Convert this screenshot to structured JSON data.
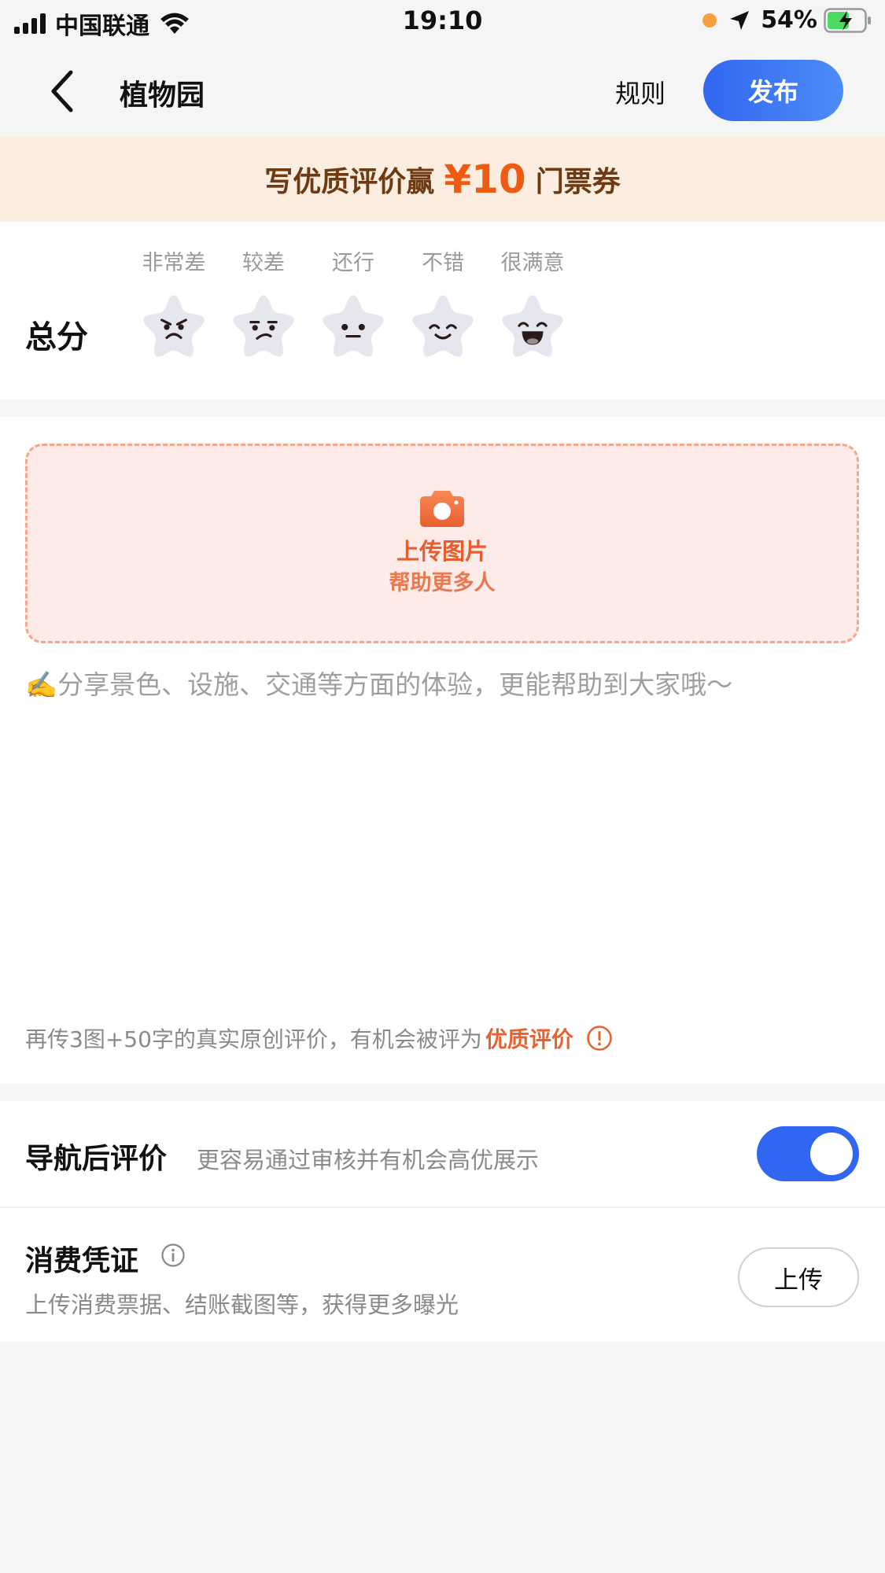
{
  "status_bar": {
    "carrier": "中国联通",
    "time": "19:10",
    "battery": "54%"
  },
  "nav": {
    "title": "植物园",
    "rules": "规则",
    "publish": "发布"
  },
  "promo": {
    "prefix": "写优质评价赢",
    "amount": "¥10",
    "suffix": "门票券"
  },
  "rating": {
    "label": "总分",
    "options": [
      {
        "caption": "非常差",
        "face": "angry-star-icon"
      },
      {
        "caption": "较差",
        "face": "unhappy-star-icon"
      },
      {
        "caption": "还行",
        "face": "neutral-star-icon"
      },
      {
        "caption": "不错",
        "face": "smile-star-icon"
      },
      {
        "caption": "很满意",
        "face": "laugh-star-icon"
      }
    ]
  },
  "upload": {
    "line1": "上传图片",
    "line2": "帮助更多人"
  },
  "review": {
    "placeholder": "✍️分享景色、设施、交通等方面的体验，更能帮助到大家哦～",
    "value": ""
  },
  "tip": {
    "text": "再传3图+50字的真实原创评价，有机会被评为",
    "highlight": "优质评价"
  },
  "nav_review": {
    "title": "导航后评价",
    "desc": "更容易通过审核并有机会高优展示",
    "enabled": true
  },
  "voucher": {
    "title": "消费凭证",
    "desc": "上传消费票据、结账截图等，获得更多曝光",
    "button": "上传"
  },
  "colors": {
    "accent_blue": "#3167f0",
    "promo_orange": "#ef5b13",
    "highlight_orange": "#e8622f"
  }
}
